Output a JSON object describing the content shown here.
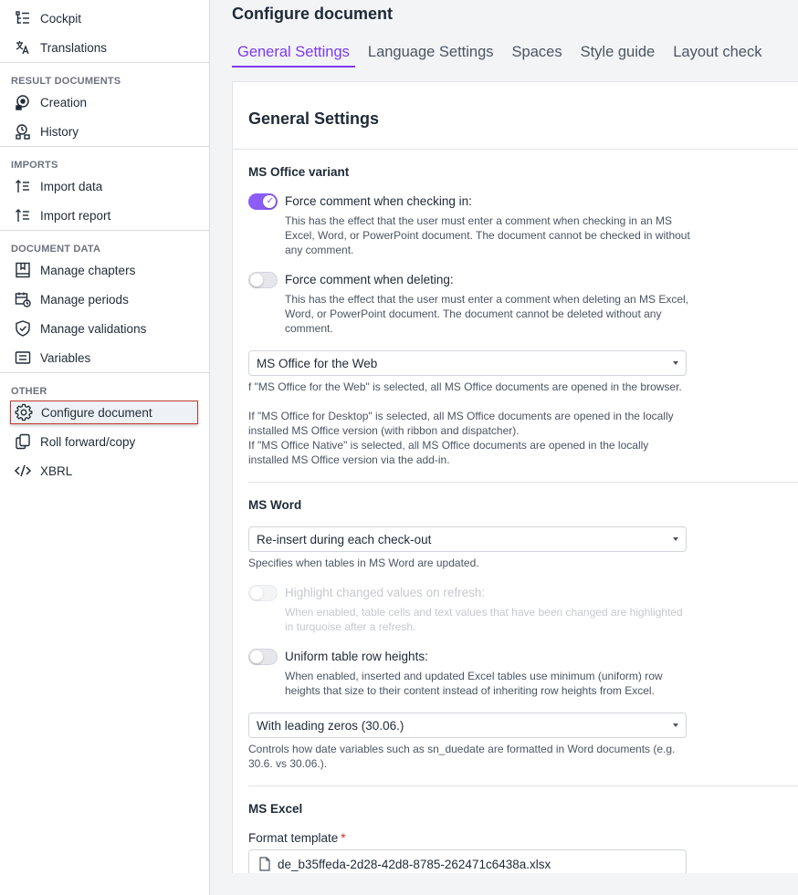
{
  "sidebar": {
    "top_items": [
      {
        "label": "Cockpit",
        "icon": "cockpit-icon"
      },
      {
        "label": "Translations",
        "icon": "translate-icon"
      }
    ],
    "sections": [
      {
        "title": "RESULT DOCUMENTS",
        "items": [
          {
            "label": "Creation"
          },
          {
            "label": "History"
          }
        ]
      },
      {
        "title": "IMPORTS",
        "items": [
          {
            "label": "Import data"
          },
          {
            "label": "Import report"
          }
        ]
      },
      {
        "title": "DOCUMENT DATA",
        "items": [
          {
            "label": "Manage chapters"
          },
          {
            "label": "Manage periods"
          },
          {
            "label": "Manage validations"
          },
          {
            "label": "Variables"
          }
        ]
      },
      {
        "title": "OTHER",
        "items": [
          {
            "label": "Configure document"
          },
          {
            "label": "Roll forward/copy"
          },
          {
            "label": "XBRL"
          }
        ]
      }
    ]
  },
  "main": {
    "title": "Configure document",
    "tabs": [
      "General Settings",
      "Language Settings",
      "Spaces",
      "Style guide",
      "Layout check"
    ],
    "card_title": "General Settings",
    "ms_office": {
      "heading": "MS Office variant",
      "force_checkin_label": "Force comment when checking in:",
      "force_checkin_desc": "This has the effect that the user must enter a comment when checking in an MS Excel, Word, or PowerPoint document. The document cannot be checked in without any comment.",
      "force_delete_label": "Force comment when deleting:",
      "force_delete_desc": "This has the effect that the user must enter a comment when deleting an MS Excel, Word, or PowerPoint document. The document cannot be deleted without any comment.",
      "variant_value": "MS Office for the Web",
      "variant_help_1": "f \"MS Office for the Web\" is selected, all MS Office documents are opened in the browser.",
      "variant_help_2": "If \"MS Office for Desktop\" is selected, all MS Office documents are opened in the locally installed MS Office version (with ribbon and dispatcher).",
      "variant_help_3": "If \"MS Office Native\" is selected, all MS Office documents are opened in the locally installed MS Office version via the add-in."
    },
    "ms_word": {
      "heading": "MS Word",
      "update_value": "Re-insert during each check-out",
      "update_help": "Specifies when tables in MS Word are updated.",
      "highlight_label": "Highlight changed values on refresh:",
      "highlight_desc": "When enabled, table cells and text values that have been changed are highlighted in turquoise after a refresh.",
      "uniform_label": "Uniform table row heights:",
      "uniform_desc": "When enabled, inserted and updated Excel tables use minimum (uniform) row heights that size to their content instead of inheriting row heights from Excel.",
      "date_value": "With leading zeros (30.06.)",
      "date_help": "Controls how date variables such as sn_duedate are formatted in Word documents (e.g. 30.6. vs 30.06.)."
    },
    "ms_excel": {
      "heading": "MS Excel",
      "template_label": "Format template",
      "required_mark": "*",
      "template_value": "de_b35ffeda-2d28-42d8-8785-262471c6438a.xlsx"
    }
  },
  "colors": {
    "accent": "#7c3aed",
    "toggle_on": "#8b5cf6",
    "highlight_border": "#c0392b"
  }
}
